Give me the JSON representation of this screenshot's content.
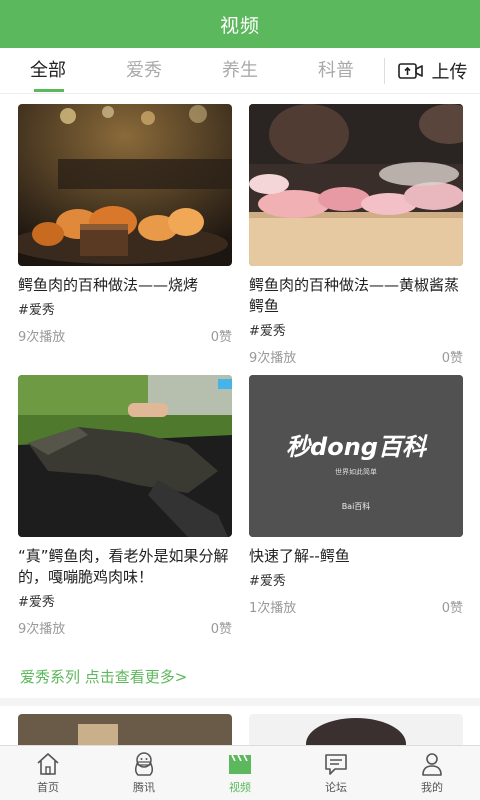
{
  "header": {
    "title": "视频"
  },
  "tabs": [
    {
      "label": "全部",
      "active": true
    },
    {
      "label": "爱秀",
      "active": false
    },
    {
      "label": "养生",
      "active": false
    },
    {
      "label": "科普",
      "active": false
    }
  ],
  "upload": {
    "label": "上传",
    "icon": "upload-video-icon"
  },
  "videos": [
    {
      "title": "鳄鱼肉的百种做法——烧烤",
      "tag": "#爱秀",
      "plays": "9次播放",
      "likes": "0赞"
    },
    {
      "title": "鳄鱼肉的百种做法——黄椒酱蒸鳄鱼",
      "tag": "#爱秀",
      "plays": "9次播放",
      "likes": "0赞"
    },
    {
      "title": "“真”鳄鱼肉，看老外是如果分解的，嘎嘣脆鸡肉味！",
      "tag": "#爱秀",
      "plays": "9次播放",
      "likes": "0赞"
    },
    {
      "title": "快速了解--鳄鱼",
      "tag": "#爱秀",
      "plays": "1次播放",
      "likes": "0赞",
      "thumb_brand": "秒dong百科",
      "thumb_sub": "世界如此简单",
      "thumb_logo": "Bai百科"
    }
  ],
  "more_link": "爱秀系列 点击查看更多>",
  "colors": {
    "accent": "#5cb85c",
    "nav_bg": "#f7f7f7"
  },
  "bottom_nav": [
    {
      "label": "首页",
      "icon": "home-icon",
      "active": false
    },
    {
      "label": "腾讯",
      "icon": "penguin-icon",
      "active": false
    },
    {
      "label": "视频",
      "icon": "clapperboard-icon",
      "active": true
    },
    {
      "label": "论坛",
      "icon": "chat-bubble-icon",
      "active": false
    },
    {
      "label": "我的",
      "icon": "user-icon",
      "active": false
    }
  ]
}
